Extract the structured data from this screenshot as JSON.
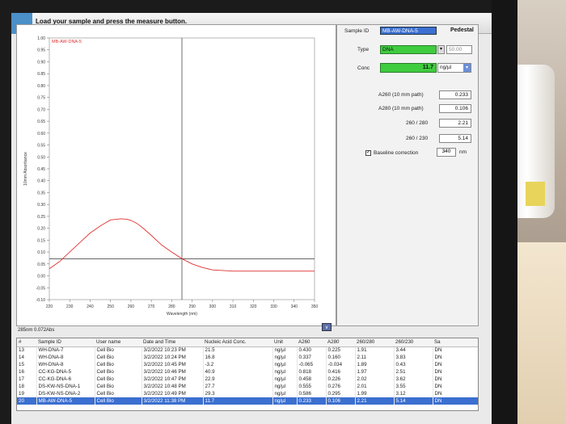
{
  "header": {
    "instruction": "Load your sample and press the measure button."
  },
  "measurement": {
    "sample_id_label": "Sample ID",
    "sample_id": "MB-AW-DNA-5",
    "pedestal_label": "Pedestal",
    "type_label": "Type",
    "type_value": "DNA",
    "type_factor": "50.00",
    "conc_label": "Conc",
    "conc_value": "11.7",
    "conc_unit": "ng/µl",
    "a260_label": "A260 (10 mm path)",
    "a260_value": "0.233",
    "a280_label": "A280 (10 mm path)",
    "a280_value": "0.106",
    "ratio_260_280_label": "260 / 280",
    "ratio_260_280_value": "2.21",
    "ratio_260_230_label": "260 / 230",
    "ratio_260_230_value": "5.14",
    "baseline_label": "Baseline correction",
    "baseline_checked": true,
    "baseline_value": "340",
    "baseline_unit": "nm"
  },
  "cursor_readout": "285nm 0.072Abs",
  "chart_data": {
    "type": "line",
    "legend": "MB-AW-DNA-5",
    "xlabel": "Wavelength (nm)",
    "ylabel": "10mm Absorbance",
    "xlim": [
      220,
      350
    ],
    "ylim": [
      -0.1,
      1.0
    ],
    "x_ticks": [
      "220",
      "230",
      "240",
      "250",
      "260",
      "270",
      "280",
      "290",
      "300",
      "310",
      "320",
      "330",
      "340",
      "350"
    ],
    "y_ticks": [
      "1.00",
      "0.95",
      "0.90",
      "0.85",
      "0.80",
      "0.75",
      "0.70",
      "0.65",
      "0.60",
      "0.55",
      "0.50",
      "0.45",
      "0.40",
      "0.35",
      "0.30",
      "0.25",
      "0.20",
      "0.15",
      "0.10",
      "0.05",
      "0.00",
      "-0.05",
      "-0.10"
    ],
    "cursor": {
      "x": 285,
      "y": 0.072
    },
    "series": [
      {
        "name": "MB-AW-DNA-5",
        "color": "#e03030",
        "x": [
          220,
          225,
          230,
          235,
          240,
          245,
          250,
          255,
          258,
          260,
          263,
          266,
          270,
          275,
          280,
          285,
          290,
          295,
          300,
          310,
          320,
          330,
          340,
          350
        ],
        "y": [
          0.03,
          0.06,
          0.1,
          0.14,
          0.18,
          0.21,
          0.235,
          0.24,
          0.238,
          0.233,
          0.22,
          0.2,
          0.17,
          0.13,
          0.1,
          0.072,
          0.05,
          0.035,
          0.025,
          0.02,
          0.02,
          0.02,
          0.02,
          0.02
        ]
      }
    ]
  },
  "table": {
    "columns": [
      "#",
      "Sample ID",
      "User name",
      "Date and Time",
      "Nucleic Acid Conc.",
      "Unit",
      "A260",
      "A280",
      "260/280",
      "260/230",
      "Sa"
    ],
    "rows": [
      [
        "13",
        "WH-DNA-7",
        "Cell Bio",
        "3/2/2022 10:23 PM",
        "21.5",
        "ng/µl",
        "0.430",
        "0.225",
        "1.91",
        "3.44",
        "DN"
      ],
      [
        "14",
        "WH-DNA-8",
        "Cell Bio",
        "3/2/2022 10:24 PM",
        "16.8",
        "ng/µl",
        "0.337",
        "0.160",
        "2.11",
        "3.83",
        "DN"
      ],
      [
        "15",
        "WH-DNA-8",
        "Cell Bio",
        "3/2/2022 10:45 PM",
        "-3.2",
        "ng/µl",
        "-0.065",
        "-0.034",
        "1.89",
        "0.43",
        "DN"
      ],
      [
        "16",
        "CC-KG-DNA-5",
        "Cell Bio",
        "3/2/2022 10:46 PM",
        "40.9",
        "ng/µl",
        "0.818",
        "0.416",
        "1.97",
        "2.51",
        "DN"
      ],
      [
        "17",
        "CC-KG-DNA-6",
        "Cell Bio",
        "3/2/2022 10:47 PM",
        "22.9",
        "ng/µl",
        "0.458",
        "0.226",
        "2.02",
        "3.62",
        "DN"
      ],
      [
        "18",
        "DS-KW-NS-DNA-1",
        "Cell Bio",
        "3/2/2022 10:48 PM",
        "27.7",
        "ng/µl",
        "0.555",
        "0.276",
        "2.01",
        "3.55",
        "DN"
      ],
      [
        "19",
        "DS-KW-NS-DNA-2",
        "Cell Bio",
        "3/2/2022 10:49 PM",
        "29.3",
        "ng/µl",
        "0.586",
        "0.295",
        "1.99",
        "3.12",
        "DN"
      ],
      [
        "20",
        "MB-AW-DNA-5",
        "Cell Bio",
        "3/2/2022 11:38 PM",
        "11.7",
        "ng/µl",
        "0.233",
        "0.106",
        "2.21",
        "5.14",
        "DN"
      ]
    ],
    "selected_row": 7
  }
}
